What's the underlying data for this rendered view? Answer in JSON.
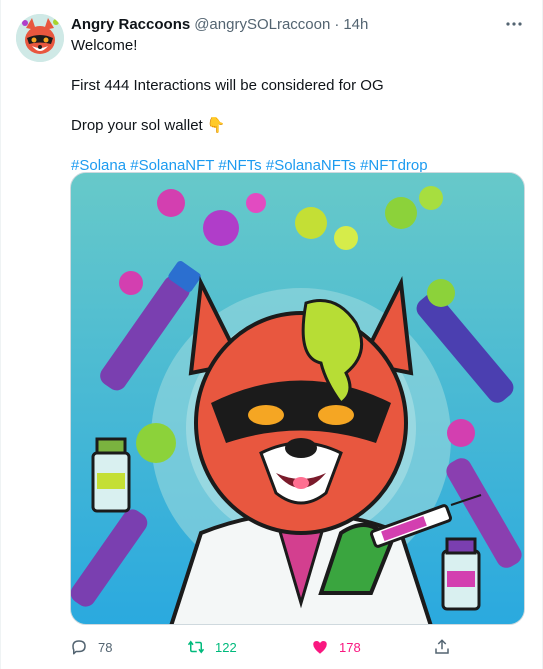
{
  "tweet": {
    "display_name": "Angry Raccoons",
    "handle": "@angrySOLraccoon",
    "separator": "·",
    "time": "14h",
    "lines": [
      "Welcome!",
      "First 444 Interactions will be considered for OG",
      "Drop your sol wallet",
      "#Solana #SolanaNFT #NFTs #SolanaNFTs #NFTdrop"
    ],
    "emoji": "👇",
    "hashtags": [
      "#Solana",
      "#SolanaNFT",
      "#NFTs",
      "#SolanaNFTs",
      "#NFTdrop"
    ]
  },
  "stats": {
    "replies": "78",
    "retweets": "122",
    "likes": "178"
  },
  "colors": {
    "link": "#1d9bf0",
    "retweet_active": "#00ba7c",
    "like_active": "#f91880",
    "muted": "#536471"
  },
  "icons": {
    "more": "more-dots-icon",
    "reply": "reply-icon",
    "retweet": "retweet-icon",
    "like": "heart-icon",
    "share": "share-icon"
  }
}
